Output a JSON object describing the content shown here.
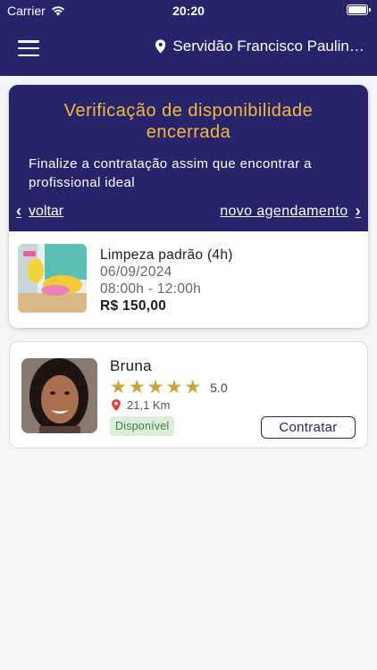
{
  "status_bar": {
    "carrier": "Carrier",
    "time": "20:20",
    "battery_level": 1.0
  },
  "header": {
    "location": "Servidão Francisco Paulino ..."
  },
  "availability_card": {
    "title": "Verificação de disponibilidade encerrada",
    "subtitle": "Finalize a contratação assim que encontrar a profissional ideal",
    "back_label": "voltar",
    "new_booking_label": "novo agendamento",
    "accent_color": "#f6b83a",
    "service": {
      "name": "Limpeza padrão (4h)",
      "date": "06/09/2024",
      "hours": "08:00h - 12:00h",
      "price": "R$ 150,00"
    }
  },
  "professional": {
    "name": "Bruna",
    "rating": "5.0",
    "stars": 5,
    "distance": "21,1 Km",
    "status": "Disponível",
    "hire_label": "Contratar"
  },
  "colors": {
    "primary": "#28246b",
    "star": "#c8a23a",
    "badge_bg": "#dbeed8",
    "badge_text": "#3c7d3c",
    "pin": "#e03a3a"
  }
}
